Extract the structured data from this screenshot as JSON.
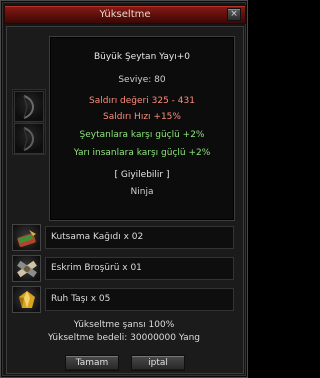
{
  "window": {
    "title": "Yükseltme",
    "close_glyph": "×"
  },
  "tooltip": {
    "item_name": "Büyük Şeytan Yayı+0",
    "level": "Seviye: 80",
    "attack_value": "Saldırı değeri 325 - 431",
    "attack_speed": "Saldırı Hızı +15%",
    "bonus_1": "Şeytanlara karşı güçlü +2%",
    "bonus_2": "Yarı insanlara karşı güçlü +2%",
    "wearable": "[ Giyilebilir ]",
    "class": "Ninja"
  },
  "preview": {
    "top_icon": "bow-icon",
    "bottom_icon": "bow-icon"
  },
  "materials": [
    {
      "label": "Kutsama Kağıdı x 02",
      "icon": "blessing-scroll-icon"
    },
    {
      "label": "Eskrim Broşürü x 01",
      "icon": "fencing-brochure-icon"
    },
    {
      "label": "Ruh Taşı x 05",
      "icon": "spirit-stone-icon"
    }
  ],
  "upgrade": {
    "chance": "Yükseltme şansı 100%",
    "cost": "Yükseltme bedeli: 30000000 Yang"
  },
  "buttons": {
    "ok": "Tamam",
    "cancel": "iptal"
  },
  "colors": {
    "title_bar": "#6e130e",
    "attack_text": "#ff8c7a",
    "bonus_text": "#8ee47e"
  }
}
